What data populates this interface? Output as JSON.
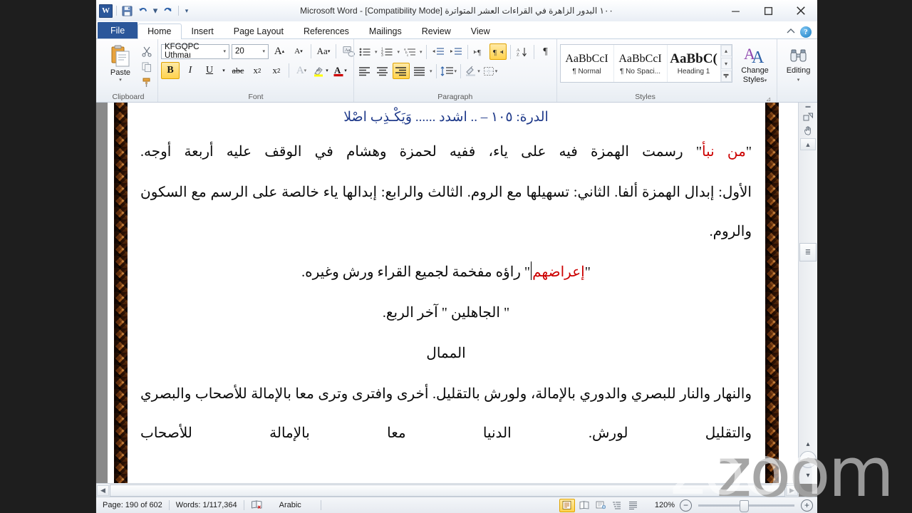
{
  "window": {
    "title": "۱۰۰ البدور الزاهرة في القراءات العشر المتواترة [Compatibility Mode]  -  Microsoft Word",
    "app_logo": "W",
    "minimize": "—",
    "maximize": "▫",
    "close": "✕"
  },
  "quick_access": {
    "save": "save-icon",
    "undo": "↶",
    "undo_arrow": "▾",
    "redo": "↻",
    "customize": "▾"
  },
  "tabs": [
    {
      "label": "File",
      "id": "file"
    },
    {
      "label": "Home",
      "id": "home"
    },
    {
      "label": "Insert",
      "id": "insert"
    },
    {
      "label": "Page Layout",
      "id": "page-layout"
    },
    {
      "label": "References",
      "id": "references"
    },
    {
      "label": "Mailings",
      "id": "mailings"
    },
    {
      "label": "Review",
      "id": "review"
    },
    {
      "label": "View",
      "id": "view"
    }
  ],
  "tab_right": {
    "minimize_ribbon": "⌃",
    "help": "?"
  },
  "ribbon": {
    "clipboard": {
      "label": "Clipboard",
      "paste": "Paste",
      "paste_caret": "▾",
      "cut": "✂",
      "copy": "⧉",
      "format_painter": "🖌",
      "dialog_launcher": "⊿"
    },
    "font": {
      "label": "Font",
      "font_name": "KFGQPC Uthmaı",
      "font_size": "20",
      "grow_font": "A",
      "shrink_font": "A",
      "change_case": "Aa",
      "clear_formatting": "Aa",
      "bold": "B",
      "italic": "I",
      "underline": "U",
      "strikethrough": "abc",
      "subscript": "x₂",
      "superscript": "x²",
      "text_effects": "A",
      "highlight": "ab",
      "font_color": "A",
      "dialog_launcher": "⊿"
    },
    "paragraph": {
      "label": "Paragraph",
      "bullets": "≔",
      "numbering": "≕",
      "multilevel": "≖",
      "decrease_indent": "⇤",
      "increase_indent": "⇥",
      "ltr_text": "¶",
      "rtl_text": "¶",
      "sort": "A↓",
      "show_marks": "¶",
      "align_left": "≡",
      "center": "≡",
      "align_right": "≡",
      "justify": "≡",
      "line_spacing": "↕",
      "shading": "▭",
      "borders": "⊞",
      "dialog_launcher": "⊿"
    },
    "styles": {
      "label": "Styles",
      "items": [
        {
          "preview": "AaBbCcI",
          "name": "¶ Normal"
        },
        {
          "preview": "AaBbCcI",
          "name": "¶ No Spaci..."
        },
        {
          "preview": "AaBbC(",
          "name": "Heading 1"
        }
      ],
      "scroll_up": "▴",
      "scroll_down": "▾",
      "more": "▾",
      "dialog_launcher": "⊿"
    },
    "change_styles": {
      "line1": "Change",
      "line2": "Styles",
      "caret": "▾"
    },
    "editing": {
      "label": "Editing",
      "caret": "▾",
      "icon": "binoculars-icon"
    }
  },
  "document": {
    "heading": "الدرة: ١٠٥ – .. اشدد ...... وَيَكْـذِب اصْلا",
    "paragraphs": [
      {
        "id": "p1",
        "align": "justify",
        "runs": [
          {
            "text": "\"",
            "color": "black"
          },
          {
            "text": "من نبأ",
            "color": "red"
          },
          {
            "text": "\" رسمت الهمزة فيه على ياء، ففيه لحمزة وهشام في الوقف عليه أربعة أوجه.",
            "color": "black"
          }
        ]
      },
      {
        "id": "p2",
        "align": "justify",
        "runs": [
          {
            "text": "الأول: إبدال الهمزة ألفا. الثاني: تسهيلها مع الروم. الثالث والرابع: إبدالها ياء خالصة على الرسم مع السكون والروم.",
            "color": "black"
          }
        ]
      },
      {
        "id": "p3",
        "align": "center",
        "runs": [
          {
            "text": "\"",
            "color": "black"
          },
          {
            "text": "إعراضهم",
            "color": "red"
          },
          {
            "text": "\" راؤه مفخمة لجميع القراء ورش وغيره.",
            "color": "black"
          }
        ]
      },
      {
        "id": "p4",
        "align": "center",
        "runs": [
          {
            "text": "\" الجاهلين \" آخر الربع.",
            "color": "black"
          }
        ]
      },
      {
        "id": "p5",
        "align": "center",
        "runs": [
          {
            "text": "الممال",
            "color": "black"
          }
        ]
      },
      {
        "id": "p6",
        "align": "justify",
        "runs": [
          {
            "text": "والنهار والنار للبصري والدوري بالإمالة، ولورش بالتقليل. أخرى وافترى وترى معا بالإمالة للأصحاب والبصري والتقليل لورش. الدنيا معا بالإمالة للأصحاب",
            "color": "black"
          }
        ]
      }
    ]
  },
  "scrollbars": {
    "v_up": "▲",
    "v_down": "▼",
    "v_thumb": "≣",
    "h_left": "◀",
    "h_right": "▶",
    "select_browse_object": "◎",
    "prev_page": "▴",
    "next_page": "▾",
    "split_handle": "▬",
    "shapes_icon": "shapes-icon",
    "hand_icon": "hand-icon"
  },
  "statusbar": {
    "page": "Page: 190 of 602",
    "words": "Words: 1/117,364",
    "language": "Arabic",
    "proofing_icon": "proofing-errors-icon",
    "zoom_level": "120%",
    "zoom_out": "−",
    "zoom_in": "+",
    "views": [
      {
        "id": "print-layout",
        "glyph": "▤",
        "active": true
      },
      {
        "id": "full-screen-reading",
        "glyph": "▥",
        "active": false
      },
      {
        "id": "web-layout",
        "glyph": "▦",
        "active": false
      },
      {
        "id": "outline",
        "glyph": "▧",
        "active": false
      },
      {
        "id": "draft",
        "glyph": "▤",
        "active": false
      }
    ]
  },
  "overlay": {
    "watermark": "zoom"
  },
  "colors": {
    "accent": "#2b579a",
    "heading": "#1f3a8a",
    "highlight_red": "#cc0000",
    "ribbon_active": "#ffd24d"
  }
}
